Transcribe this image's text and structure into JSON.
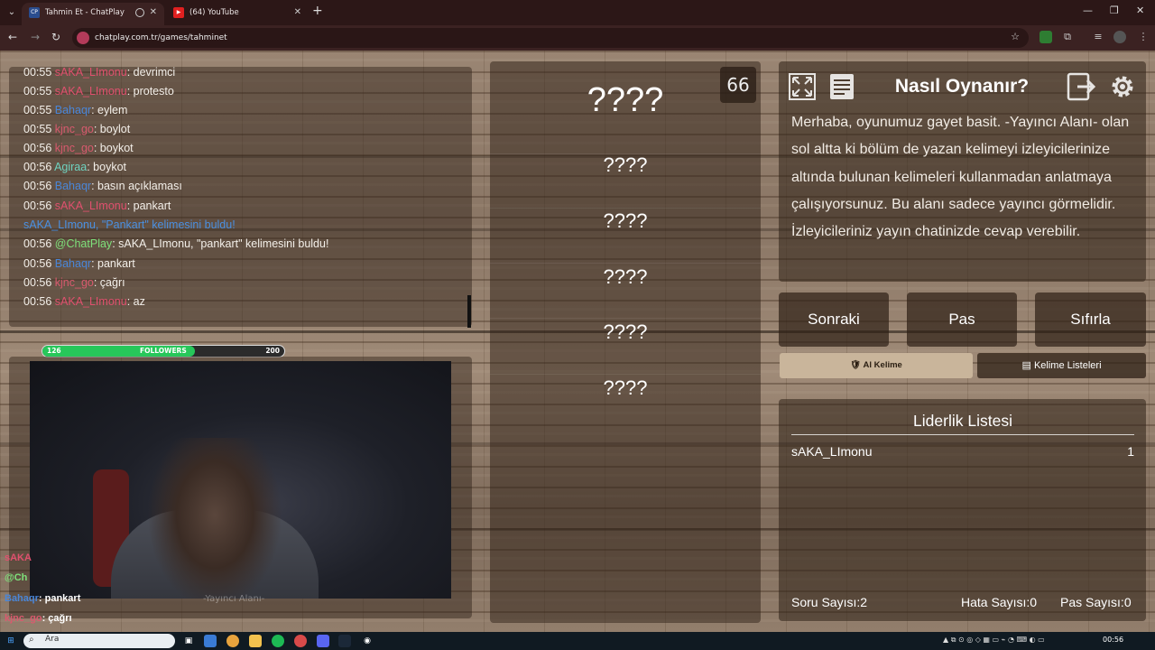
{
  "browser": {
    "tabs": [
      {
        "label": "Tahmin Et - ChatPlay",
        "favicon": "CP",
        "active": true
      },
      {
        "label": "(64) YouTube",
        "favicon": "▶",
        "active": false
      }
    ],
    "url": "chatplay.com.tr/games/tahminet"
  },
  "chat": {
    "lines": [
      {
        "time": "00:55",
        "user": "sAKA_LImonu",
        "color": "#e0506e",
        "msg": ": devrimci"
      },
      {
        "time": "00:55",
        "user": "sAKA_LImonu",
        "color": "#e0506e",
        "msg": ": protesto"
      },
      {
        "time": "00:55",
        "user": "Bahaqr",
        "color": "#4a86d8",
        "msg": ": eylem"
      },
      {
        "time": "00:55",
        "user": "kjnc_go",
        "color": "#d85a6e",
        "msg": ": boylot"
      },
      {
        "time": "00:56",
        "user": "kjnc_go",
        "color": "#d85a6e",
        "msg": ": boykot"
      },
      {
        "time": "00:56",
        "user": "Agiraa",
        "color": "#6fd3c0",
        "msg": ": boykot"
      },
      {
        "time": "00:56",
        "user": "Bahaqr",
        "color": "#4a86d8",
        "msg": ": basın açıklaması"
      },
      {
        "time": "00:56",
        "user": "sAKA_LImonu",
        "color": "#e0506e",
        "msg": ": pankart"
      },
      {
        "time": "",
        "user": "",
        "color": "#4a90e2",
        "msg": "sAKA_LImonu, \"Pankart\" kelimesini buldu!"
      },
      {
        "time": "00:56",
        "user": "@ChatPlay",
        "color": "#7ee07a",
        "msg": ": sAKA_LImonu, \"pankart\" kelimesini buldu!"
      },
      {
        "time": "00:56",
        "user": "Bahaqr",
        "color": "#4a86d8",
        "msg": ": pankart"
      },
      {
        "time": "00:56",
        "user": "kjnc_go",
        "color": "#d85a6e",
        "msg": ": çağrı"
      },
      {
        "time": "00:56",
        "user": "sAKA_LImonu",
        "color": "#e0506e",
        "msg": ": az"
      }
    ]
  },
  "followers": {
    "current": "126",
    "label": "FOLLOWERS",
    "goal": "200",
    "progress": 0.63
  },
  "stream": {
    "label": "-Yayıncı Alanı-",
    "overlay_chat": [
      {
        "user": "sAKA",
        "msg": "",
        "color": "#e0506e"
      },
      {
        "user": "@Ch",
        "msg": "",
        "color": "#7ee07a"
      },
      {
        "user": "Bahaqr",
        "msg": ": pankart",
        "color": "#4a86d8"
      },
      {
        "user": "kjnc_go",
        "msg": ": çağrı",
        "color": "#d85a6e"
      }
    ]
  },
  "game": {
    "timer": "66",
    "slots": [
      "????",
      "????",
      "????",
      "????",
      "????",
      "????"
    ]
  },
  "howto": {
    "title": "Nasıl Oynanır?",
    "text": "Merhaba, oyunumuz gayet basit. -Yayıncı Alanı- olan sol altta ki bölüm de yazan kelimeyi izleyicilerinize altında bulunan kelimeleri kullanmadan anlatmaya çalışıyorsunuz. Bu alanı sadece yayıncı görmelidir. İzleyicileriniz yayın chatinizde cevap verebilir."
  },
  "controls": {
    "next": "Sonraki",
    "pass": "Pas",
    "reset": "Sıfırla",
    "ai_word": "Al Kelime",
    "word_lists": "Kelime Listeleri"
  },
  "leaderboard": {
    "title": "Liderlik Listesi",
    "rows": [
      {
        "name": "sAKA_LImonu",
        "score": "1"
      }
    ]
  },
  "stats": {
    "questions_label": "Soru Sayısı:",
    "questions": "2",
    "errors_label": "Hata Sayısı:",
    "errors": "0",
    "passes_label": "Pas Sayısı:",
    "passes": "0"
  },
  "taskbar": {
    "search_placeholder": "Ara",
    "time": "00:56"
  },
  "colors": {
    "accent_green": "#27c75a",
    "wood": "#8a7665"
  }
}
